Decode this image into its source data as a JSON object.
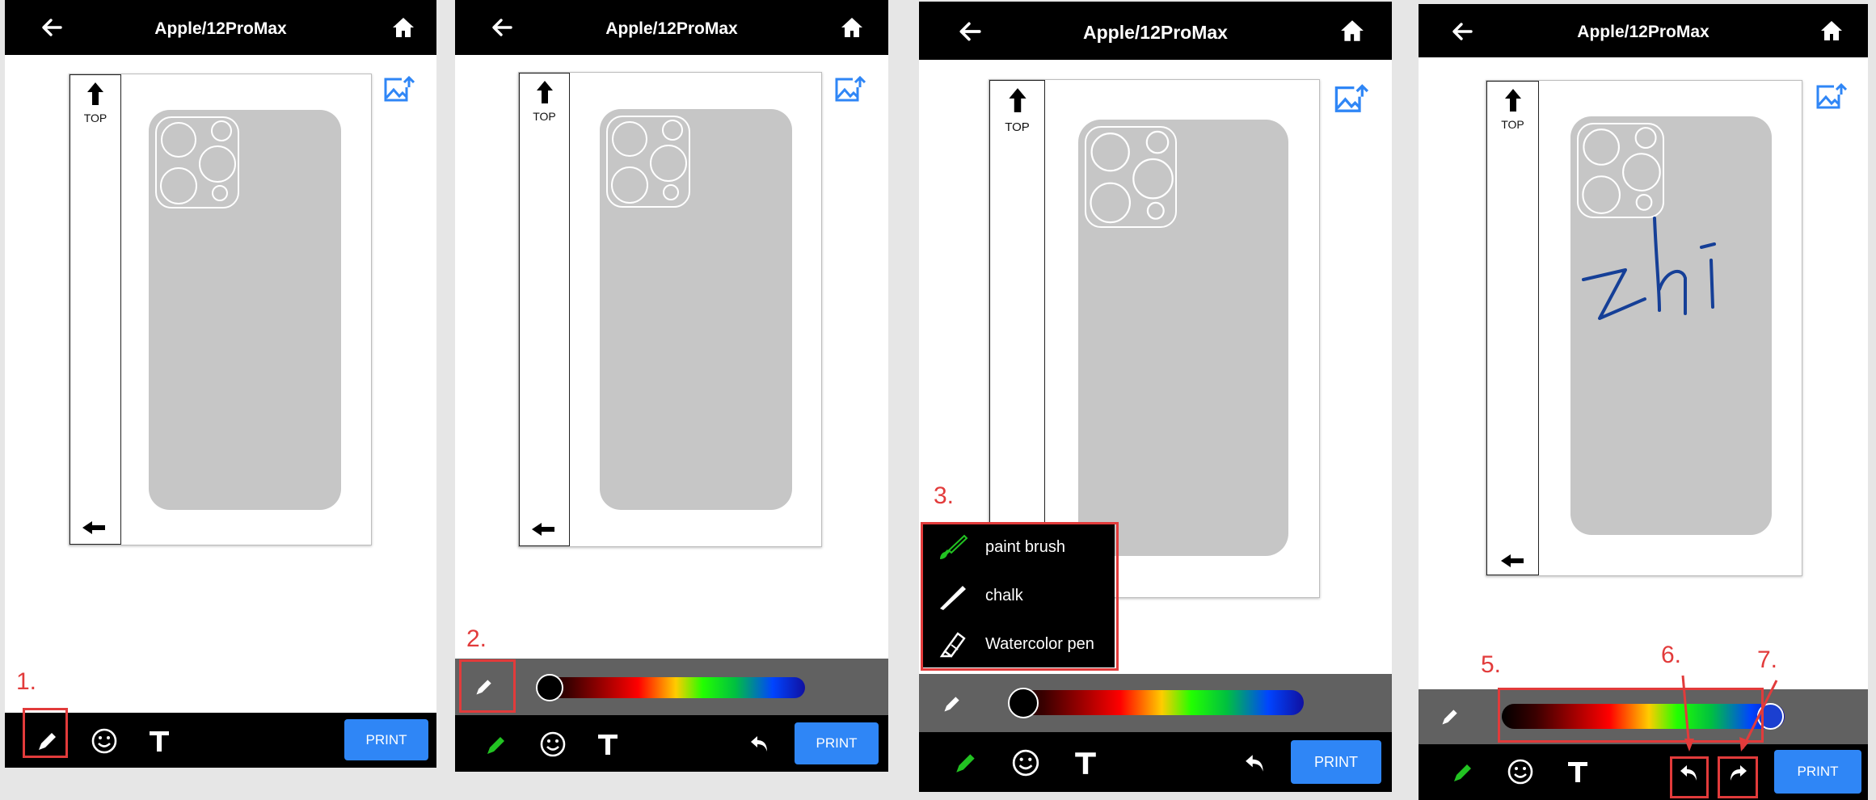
{
  "header": {
    "title": "Apple/12ProMax",
    "back_icon": "arrow-left-icon",
    "home_icon": "home-icon"
  },
  "canvas": {
    "top_label": "TOP",
    "upload_icon": "image-upload-icon",
    "strip_up_icon": "arrow-up-icon",
    "strip_left_icon": "arrow-left-icon"
  },
  "toolbar": {
    "print_label": "PRINT",
    "pen_icon": "pen-icon",
    "emoji_icon": "emoji-icon",
    "text_icon": "text-icon",
    "undo_icon": "undo-icon",
    "redo_icon": "redo-icon"
  },
  "brush_menu": {
    "items": [
      {
        "label": "paint brush",
        "icon": "paint-brush-icon"
      },
      {
        "label": "chalk",
        "icon": "chalk-icon"
      },
      {
        "label": "Watercolor pen",
        "icon": "watercolor-pen-icon"
      }
    ]
  },
  "color_slider": {
    "panel2_position": 0.0,
    "panel3_position": 0.0,
    "panel4_position": 0.92
  },
  "drawing": {
    "handwriting": "zhi",
    "color": "#153f97"
  },
  "steps": {
    "s1": "1.",
    "s2": "2.",
    "s3": "3.",
    "s5": "5.",
    "s6": "6.",
    "s7": "7."
  },
  "colors": {
    "accent": "#2f86f6",
    "annotation": "#e23b3b",
    "active_pen": "#22c322"
  }
}
